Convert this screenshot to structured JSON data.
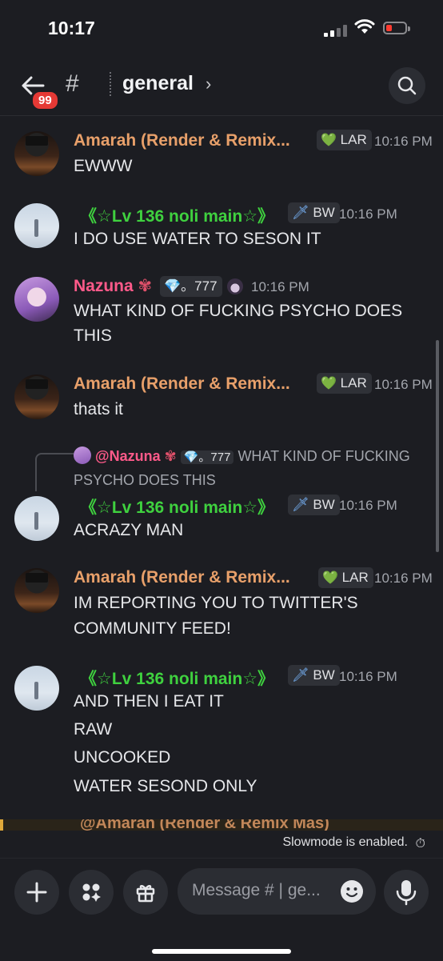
{
  "status_bar": {
    "time": "10:17"
  },
  "header": {
    "unread_badge": "99",
    "channel_name": "general"
  },
  "messages": [
    {
      "author": "Amarah (Render & Remix...",
      "tag": "LAR",
      "timestamp": "10:16 PM",
      "lines": [
        "EWWW"
      ]
    },
    {
      "author": "《☆Lv 136 noli main☆》",
      "tag": "BW",
      "timestamp": "10:16 PM",
      "lines": [
        "I DO USE WATER TO SESON IT"
      ]
    },
    {
      "author": "Nazuna",
      "tag": "。777",
      "timestamp": "10:16 PM",
      "lines": [
        "WHAT KIND OF FUCKING PSYCHO DOES",
        "THIS"
      ]
    },
    {
      "author": "Amarah (Render & Remix...",
      "tag": "LAR",
      "timestamp": "10:16 PM",
      "lines": [
        "thats it"
      ]
    },
    {
      "author": "《☆Lv 136 noli main☆》",
      "tag": "BW",
      "timestamp": "10:16 PM",
      "lines": [
        "ACRAZY MAN"
      ],
      "reply": {
        "author": "@Nazuna",
        "tag": "。777",
        "text_line1": "WHAT KIND OF FUCKING",
        "text_line2": "PSYCHO DOES THIS"
      }
    },
    {
      "author": "Amarah (Render & Remix...",
      "tag": "LAR",
      "timestamp": "10:16 PM",
      "lines": [
        "IM REPORTING YOU TO TWITTER'S",
        "COMMUNITY FEED!"
      ]
    },
    {
      "author": "《☆Lv 136 noli main☆》",
      "tag": "BW",
      "timestamp": "10:16 PM",
      "lines": [
        "AND THEN I EAT IT",
        "RAW",
        "UNCOOKED",
        "WATER SESOND ONLY"
      ]
    }
  ],
  "peek_author": "@Amarah (Render & Remix Mas)",
  "slowmode_text": "Slowmode is enabled.",
  "composer": {
    "placeholder": "Message # | ge..."
  },
  "colors": {
    "background": "#1c1d22",
    "amarah_name": "#e8a06a",
    "lv_name": "#3fd13f",
    "nazuna_name": "#ff5a8a",
    "badge": "#e53935"
  }
}
